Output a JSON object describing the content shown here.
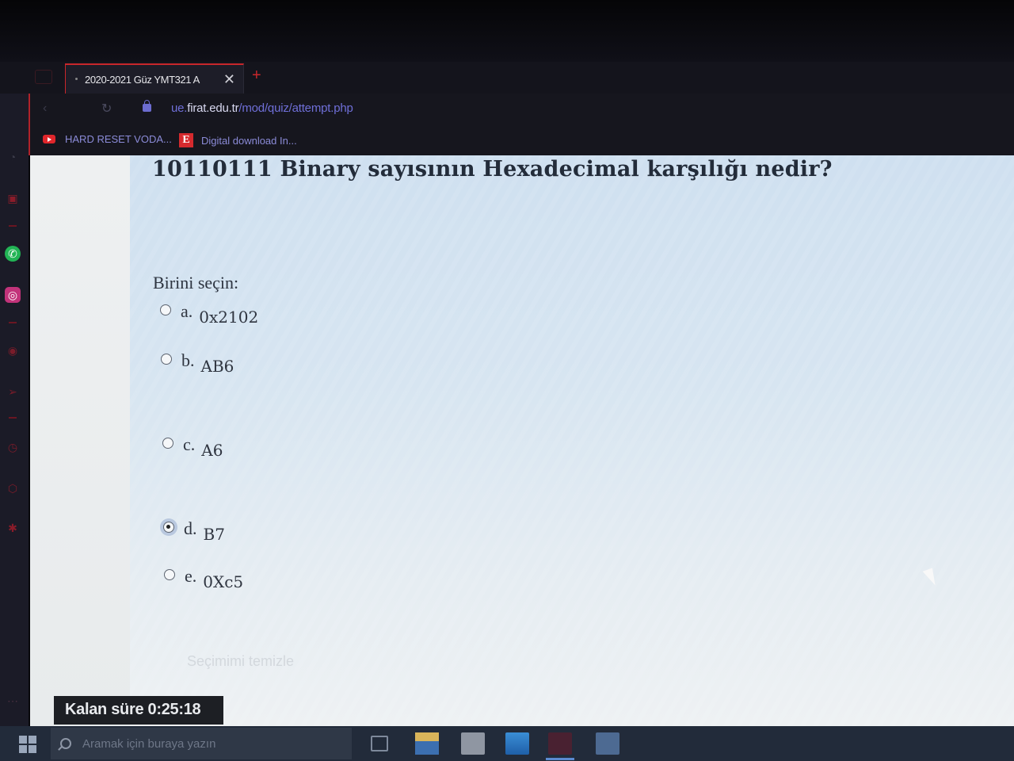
{
  "browser": {
    "tab_title": "2020-2021 Güz YMT321 A",
    "tab_close": "✕",
    "new_tab": "+",
    "url_prefix": "ue.",
    "url_host": "firat.edu.tr",
    "url_path": "/mod/quiz/attempt.php",
    "bookmarks": [
      {
        "label": "HARD RESET VODA...",
        "icon": "youtube-icon"
      },
      {
        "label": "Digital download In...",
        "icon": "e-icon",
        "icon_text": "E"
      }
    ]
  },
  "quiz": {
    "question": "10110111  Binary sayısının Hexadecimal karşılığı nedir?",
    "prompt": "Birini seçin:",
    "options": [
      {
        "letter": "a.",
        "text": "0x2102",
        "selected": false
      },
      {
        "letter": "b.",
        "text": "AB6",
        "selected": false
      },
      {
        "letter": "c.",
        "text": "A6",
        "selected": false
      },
      {
        "letter": "d.",
        "text": "B7",
        "selected": true
      },
      {
        "letter": "e.",
        "text": "0Xc5",
        "selected": false
      }
    ],
    "clear_choice": "Seçimimi temizle"
  },
  "timer": {
    "label": "Kalan süre 0:25:18"
  },
  "taskbar": {
    "search_placeholder": "Aramak için buraya yazın"
  },
  "colors": {
    "accent_red": "#c8262b",
    "link_purple": "#6f6fd8",
    "taskbar": "#222b3a"
  }
}
